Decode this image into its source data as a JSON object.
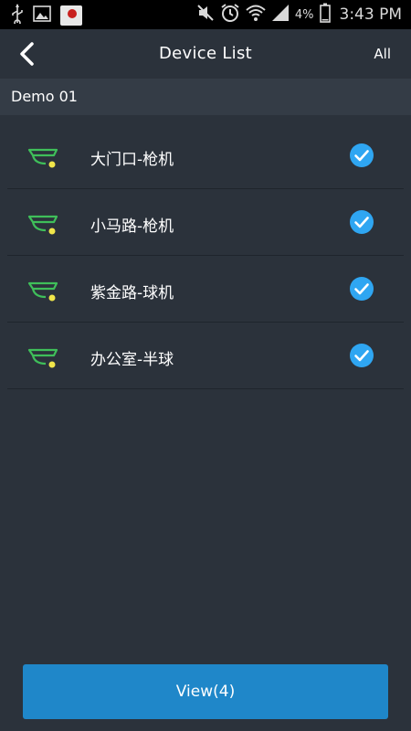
{
  "status_bar": {
    "battery": "4%",
    "time": "3:43 PM",
    "icons": [
      "usb-icon",
      "image-icon",
      "app-notification-icon",
      "mute-icon",
      "alarm-icon",
      "wifi-icon",
      "signal-icon",
      "battery-icon"
    ]
  },
  "header": {
    "title": "Device List",
    "all_label": "All"
  },
  "group": {
    "name": "Demo 01"
  },
  "devices": [
    {
      "name": "大门口-枪机",
      "checked": true
    },
    {
      "name": "小马路-枪机",
      "checked": true
    },
    {
      "name": "紫金路-球机",
      "checked": true
    },
    {
      "name": "办公室-半球",
      "checked": true
    }
  ],
  "colors": {
    "background": "#2b323b",
    "accent": "#1f87c9",
    "check": "#2fa6f2",
    "camera_icon": "#3fbf5a",
    "camera_dot": "#f0e64a"
  },
  "footer": {
    "view_label": "View(4)"
  }
}
